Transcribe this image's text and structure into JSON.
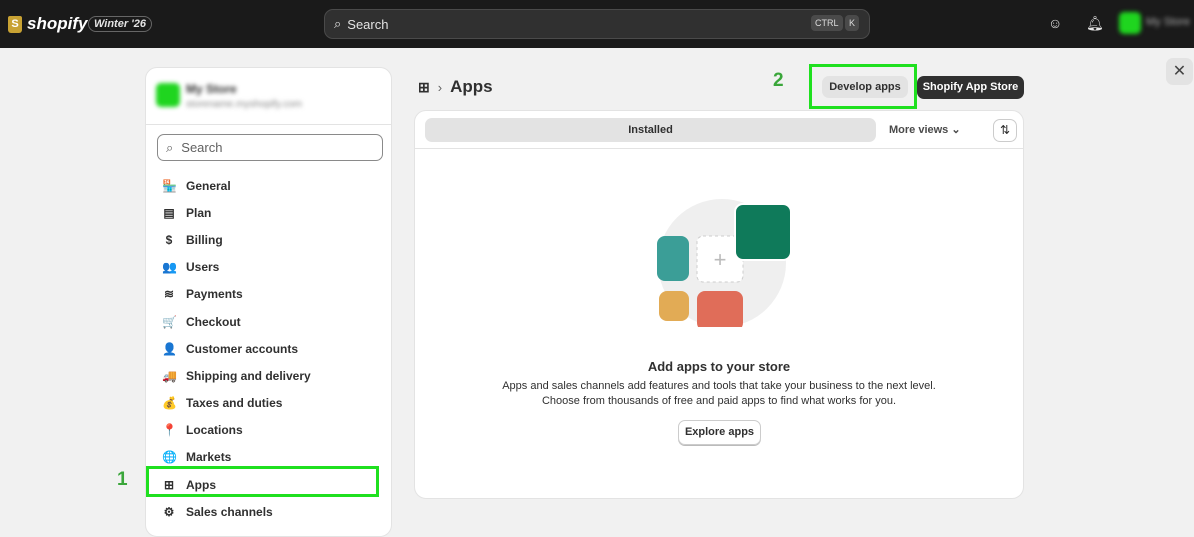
{
  "topbar": {
    "logo": "shopify",
    "version_badge": "Winter '26",
    "search_placeholder": "Search",
    "kbd_ctrl": "CTRL",
    "kbd_k": "K",
    "account_name": "My Store"
  },
  "sidebar": {
    "store_name": "My Store",
    "store_url": "storename.myshopify.com",
    "search_placeholder": "Search",
    "items": [
      {
        "label": "General",
        "icon": "🏪"
      },
      {
        "label": "Plan",
        "icon": "▤"
      },
      {
        "label": "Billing",
        "icon": "$"
      },
      {
        "label": "Users",
        "icon": "👥"
      },
      {
        "label": "Payments",
        "icon": "≋"
      },
      {
        "label": "Checkout",
        "icon": "🛒"
      },
      {
        "label": "Customer accounts",
        "icon": "👤"
      },
      {
        "label": "Shipping and delivery",
        "icon": "🚚"
      },
      {
        "label": "Taxes and duties",
        "icon": "💰"
      },
      {
        "label": "Locations",
        "icon": "📍"
      },
      {
        "label": "Markets",
        "icon": "🌐"
      },
      {
        "label": "Apps",
        "icon": "⊞"
      },
      {
        "label": "Sales channels",
        "icon": "⚙"
      }
    ]
  },
  "annotations": {
    "one": "1",
    "two": "2"
  },
  "main": {
    "breadcrumb": "Apps",
    "develop_apps": "Develop apps",
    "app_store": "Shopify App Store",
    "tab_installed": "Installed",
    "more_views": "More views",
    "empty_title": "Add apps to your store",
    "empty_line1": "Apps and sales channels add features and tools that take your business to the next level.",
    "empty_line2": "Choose from thousands of free and paid apps to find what works for you.",
    "explore": "Explore apps"
  },
  "colors": {
    "highlight": "#1fe01f",
    "topbar": "#1a1a1a"
  }
}
